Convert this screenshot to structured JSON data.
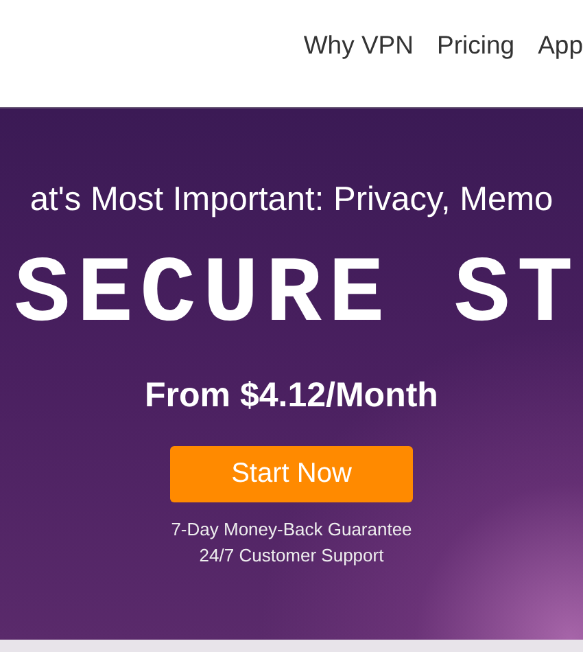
{
  "nav": {
    "links": [
      "Why VPN",
      "Pricing",
      "App"
    ]
  },
  "hero": {
    "tagline": "at's Most Important: Privacy, Memo",
    "headline": "SECURE ST",
    "price": "From $4.12/Month",
    "cta": "Start Now",
    "notes": [
      "7-Day Money-Back Guarantee",
      "24/7 Customer Support"
    ]
  }
}
